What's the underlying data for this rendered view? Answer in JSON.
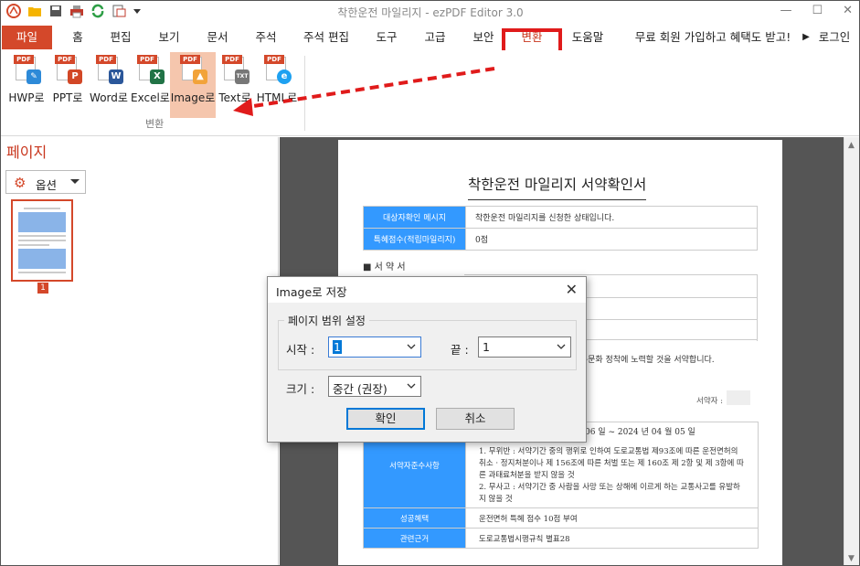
{
  "app": {
    "title": "착한운전 마일리지 - ezPDF Editor 3.0"
  },
  "menu": {
    "tabs": [
      "파일",
      "홈",
      "편집",
      "보기",
      "문서",
      "주석",
      "주석 편집",
      "도구",
      "고급",
      "보안",
      "변환",
      "도움말"
    ],
    "active_tab": "변환",
    "promo": "무료 회원 가입하고 혜택도 받고!",
    "login": "로그인"
  },
  "ribbon": {
    "buttons": [
      {
        "label": "HWP로",
        "badge": "hwp",
        "color": "#2d8ad8"
      },
      {
        "label": "PPT로",
        "badge": "P",
        "color": "#d24726"
      },
      {
        "label": "Word로",
        "badge": "W",
        "color": "#2b579a"
      },
      {
        "label": "Excel로",
        "badge": "X",
        "color": "#217346"
      },
      {
        "label": "Image로",
        "badge": "img",
        "color": "#f2a33a"
      },
      {
        "label": "Text로",
        "badge": "TXT",
        "color": "#777777"
      },
      {
        "label": "HTML로",
        "badge": "e",
        "color": "#1ea1f1"
      }
    ],
    "selected": "Image로",
    "group_label": "변환",
    "pdf_tag": "PDF"
  },
  "left_panel": {
    "title": "페이지",
    "option_button": "옵션",
    "page_number": "1"
  },
  "document": {
    "title": "착한운전 마일리지 서약확인서",
    "table1": [
      {
        "header": "대상자확인 메시지",
        "value": "착한운전 마일리지를 신청한 상태입니다."
      },
      {
        "header": "특혜점수(적립마일리지)",
        "value": "0점"
      }
    ],
    "section": "■ 서 약 서",
    "pledge_sentence": "선진교통문화 정착에 노력할 것을 서약합니다.",
    "signer_label": "서약자 :",
    "date_range": "06 일 ~ 2024 년 04 월 05 일",
    "table2": [
      {
        "header": "서약자준수사항",
        "value": "1. 무위반 : 서약기간 중의 행위로 인하여 도로교통법 제93조에 따른 운전면허의 취소 · 정지처분이나 제 156조에 따른 처벌 또는 제 160조 제 2항 및 제 3항에 따른 과태료처분을 받지 않을 것\n2. 무사고 : 서약기간 중 사람을 사망 또는 상해에 이르게 하는 교통사고를 유발하지 않을 것"
      },
      {
        "header": "성공혜택",
        "value": "운전면허 특혜 점수 10점 부여"
      },
      {
        "header": "관련근거",
        "value": "도로교통법시행규칙 별표28"
      }
    ]
  },
  "dialog": {
    "title": "Image로 저장",
    "group_label": "페이지 범위 설정",
    "start_label": "시작 :",
    "start_value": "1",
    "end_label": "끝 :",
    "end_value": "1",
    "size_label": "크기 :",
    "size_value": "중간 (권장)",
    "ok_label": "확인",
    "cancel_label": "취소"
  },
  "colors": {
    "accent": "#d4482a",
    "highlight_box": "#e01b1b",
    "table_header": "#3399ff",
    "selection": "#f5c6ad"
  }
}
